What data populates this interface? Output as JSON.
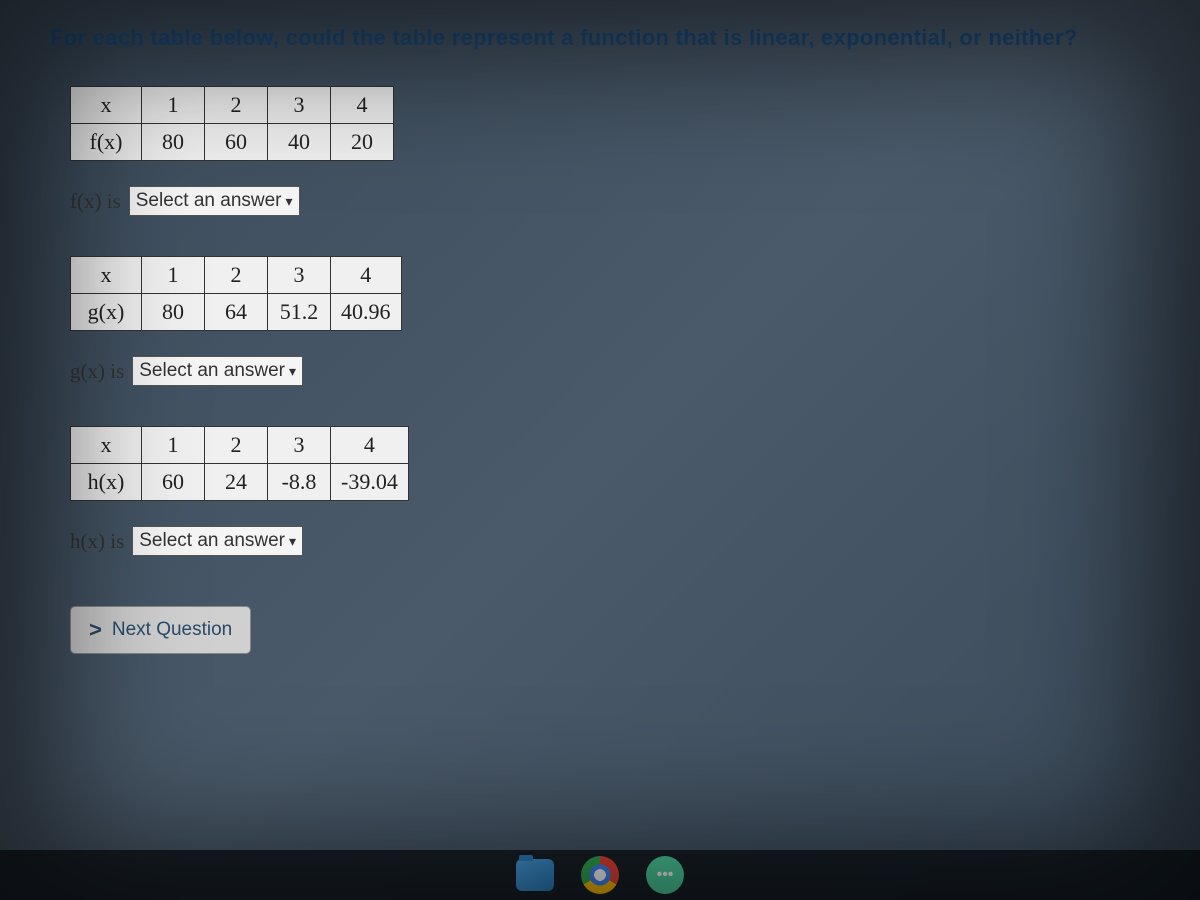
{
  "question": "For each table below, could the table represent a function that is linear, exponential, or neither?",
  "tables": {
    "f": {
      "row1_label": "x",
      "row2_label": "f(x)",
      "xvals": [
        "1",
        "2",
        "3",
        "4"
      ],
      "yvals": [
        "80",
        "60",
        "40",
        "20"
      ],
      "answer_prefix": "f(x) is",
      "select_placeholder": "Select an answer"
    },
    "g": {
      "row1_label": "x",
      "row2_label": "g(x)",
      "xvals": [
        "1",
        "2",
        "3",
        "4"
      ],
      "yvals": [
        "80",
        "64",
        "51.2",
        "40.96"
      ],
      "answer_prefix": "g(x) is",
      "select_placeholder": "Select an answer"
    },
    "h": {
      "row1_label": "x",
      "row2_label": "h(x)",
      "xvals": [
        "1",
        "2",
        "3",
        "4"
      ],
      "yvals": [
        "60",
        "24",
        "-8.8",
        "-39.04"
      ],
      "answer_prefix": "h(x) is",
      "select_placeholder": "Select an answer"
    }
  },
  "next_button": "Next Question",
  "next_arrow": ">"
}
